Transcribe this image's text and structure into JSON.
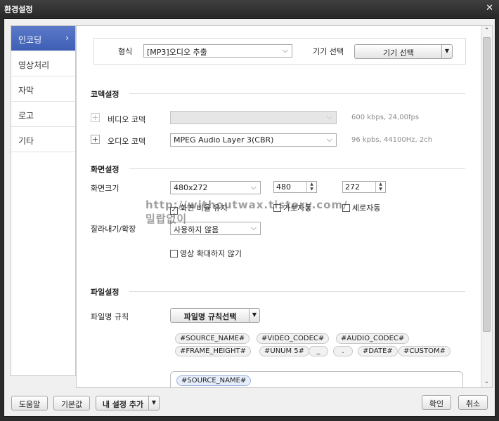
{
  "window": {
    "title": "환경설정",
    "close_glyph": "✕"
  },
  "sidebar": {
    "items": [
      {
        "label": "인코딩",
        "active": true
      },
      {
        "label": "영상처리"
      },
      {
        "label": "자막"
      },
      {
        "label": "로고"
      },
      {
        "label": "기타"
      }
    ],
    "active_chevron": "›"
  },
  "format": {
    "label": "형식",
    "value": "[MP3]오디오 추출",
    "device_label": "기기 선택",
    "device_button": "기기 선택"
  },
  "codec": {
    "section_title": "코덱설정",
    "video_label": "비디오 코덱",
    "video_value": "",
    "video_hint": "600 kbps, 24,00fps",
    "audio_label": "오디오 코덱",
    "audio_value": "MPEG Audio Layer 3(CBR)",
    "audio_hint": "96 kpbs, 44100Hz, 2ch"
  },
  "screen": {
    "section_title": "화면설정",
    "size_label": "화면크기",
    "size_value": "480x272",
    "width_value": "480",
    "height_value": "272",
    "keep_ratio_label": "화면 비율 유지",
    "keep_ratio_checked": true,
    "auto_width_label": "가로자동",
    "auto_height_label": "세로자동",
    "crop_label": "잘라내기/확장",
    "crop_value": "사용하지 않음",
    "no_upscale_label": "영상 확대하지 않기"
  },
  "file": {
    "section_title": "파일설정",
    "rule_label": "파일명 규칙",
    "rule_button": "파일명 규칙선택",
    "tokens_row1": [
      "#SOURCE_NAME#",
      "#VIDEO_CODEC#",
      "#AUDIO_CODEC#"
    ],
    "tokens_row2": [
      "#FRAME_HEIGHT#",
      "#UNUM 5#",
      "_",
      ".",
      "#DATE#",
      "#CUSTOM#"
    ],
    "current_rule_token": "#SOURCE_NAME#"
  },
  "watermark": {
    "line1": "http://withoutwax.tistory.com/",
    "line2": "밀랍없이"
  },
  "footer": {
    "help": "도움말",
    "defaults": "기본값",
    "add_preset": "내 설정 추가",
    "ok": "확인",
    "cancel": "취소"
  },
  "icons": {
    "plus": "+",
    "dropdown_arrow": "⌵",
    "split_arrow": "▼",
    "spin_up": "▲",
    "spin_down": "▼",
    "check": "✓",
    "scroll_up": "⌃",
    "scroll_down": "⌄"
  }
}
